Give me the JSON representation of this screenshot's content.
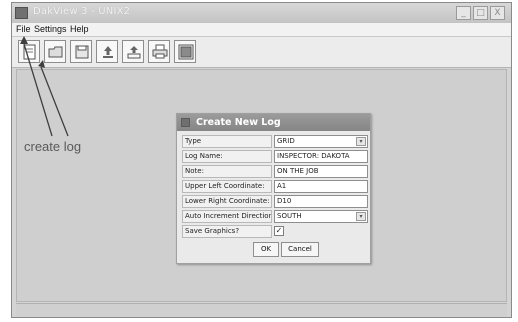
{
  "window": {
    "title": "DakView 3 - UNIX2",
    "controls": {
      "minimize": "_",
      "maximize": "□",
      "close": "X"
    }
  },
  "menu": [
    "File",
    "Settings",
    "Help"
  ],
  "toolbar": {
    "buttons": [
      "new-log-icon",
      "open-log-icon",
      "save-log-icon",
      "upload-icon",
      "export-icon",
      "print-icon",
      "grid-icon"
    ]
  },
  "annotation": {
    "text": "create log"
  },
  "dialog": {
    "title": "Create New Log",
    "fields": [
      {
        "label": "Type",
        "value": "GRID",
        "kind": "select"
      },
      {
        "label": "Log Name:",
        "value": "INSPECTOR: DAKOTA",
        "kind": "text"
      },
      {
        "label": "Note:",
        "value": "ON THE JOB",
        "kind": "text"
      },
      {
        "label": "Upper Left Coordinate:",
        "value": "A1",
        "kind": "text"
      },
      {
        "label": "Lower Right Coordinate:",
        "value": "D10",
        "kind": "text"
      },
      {
        "label": "Auto Increment Direction:",
        "value": "SOUTH",
        "kind": "select"
      },
      {
        "label": "Save Graphics?",
        "checked": true,
        "check_glyph": "✓",
        "kind": "checkbox"
      }
    ],
    "dropdown_glyph": "▾",
    "ok_label": "OK",
    "cancel_label": "Cancel"
  },
  "colors": {
    "workspace": "#cfcfcf",
    "dialog_title": "#8f8f8f",
    "annotation": "#5a5a5a"
  }
}
